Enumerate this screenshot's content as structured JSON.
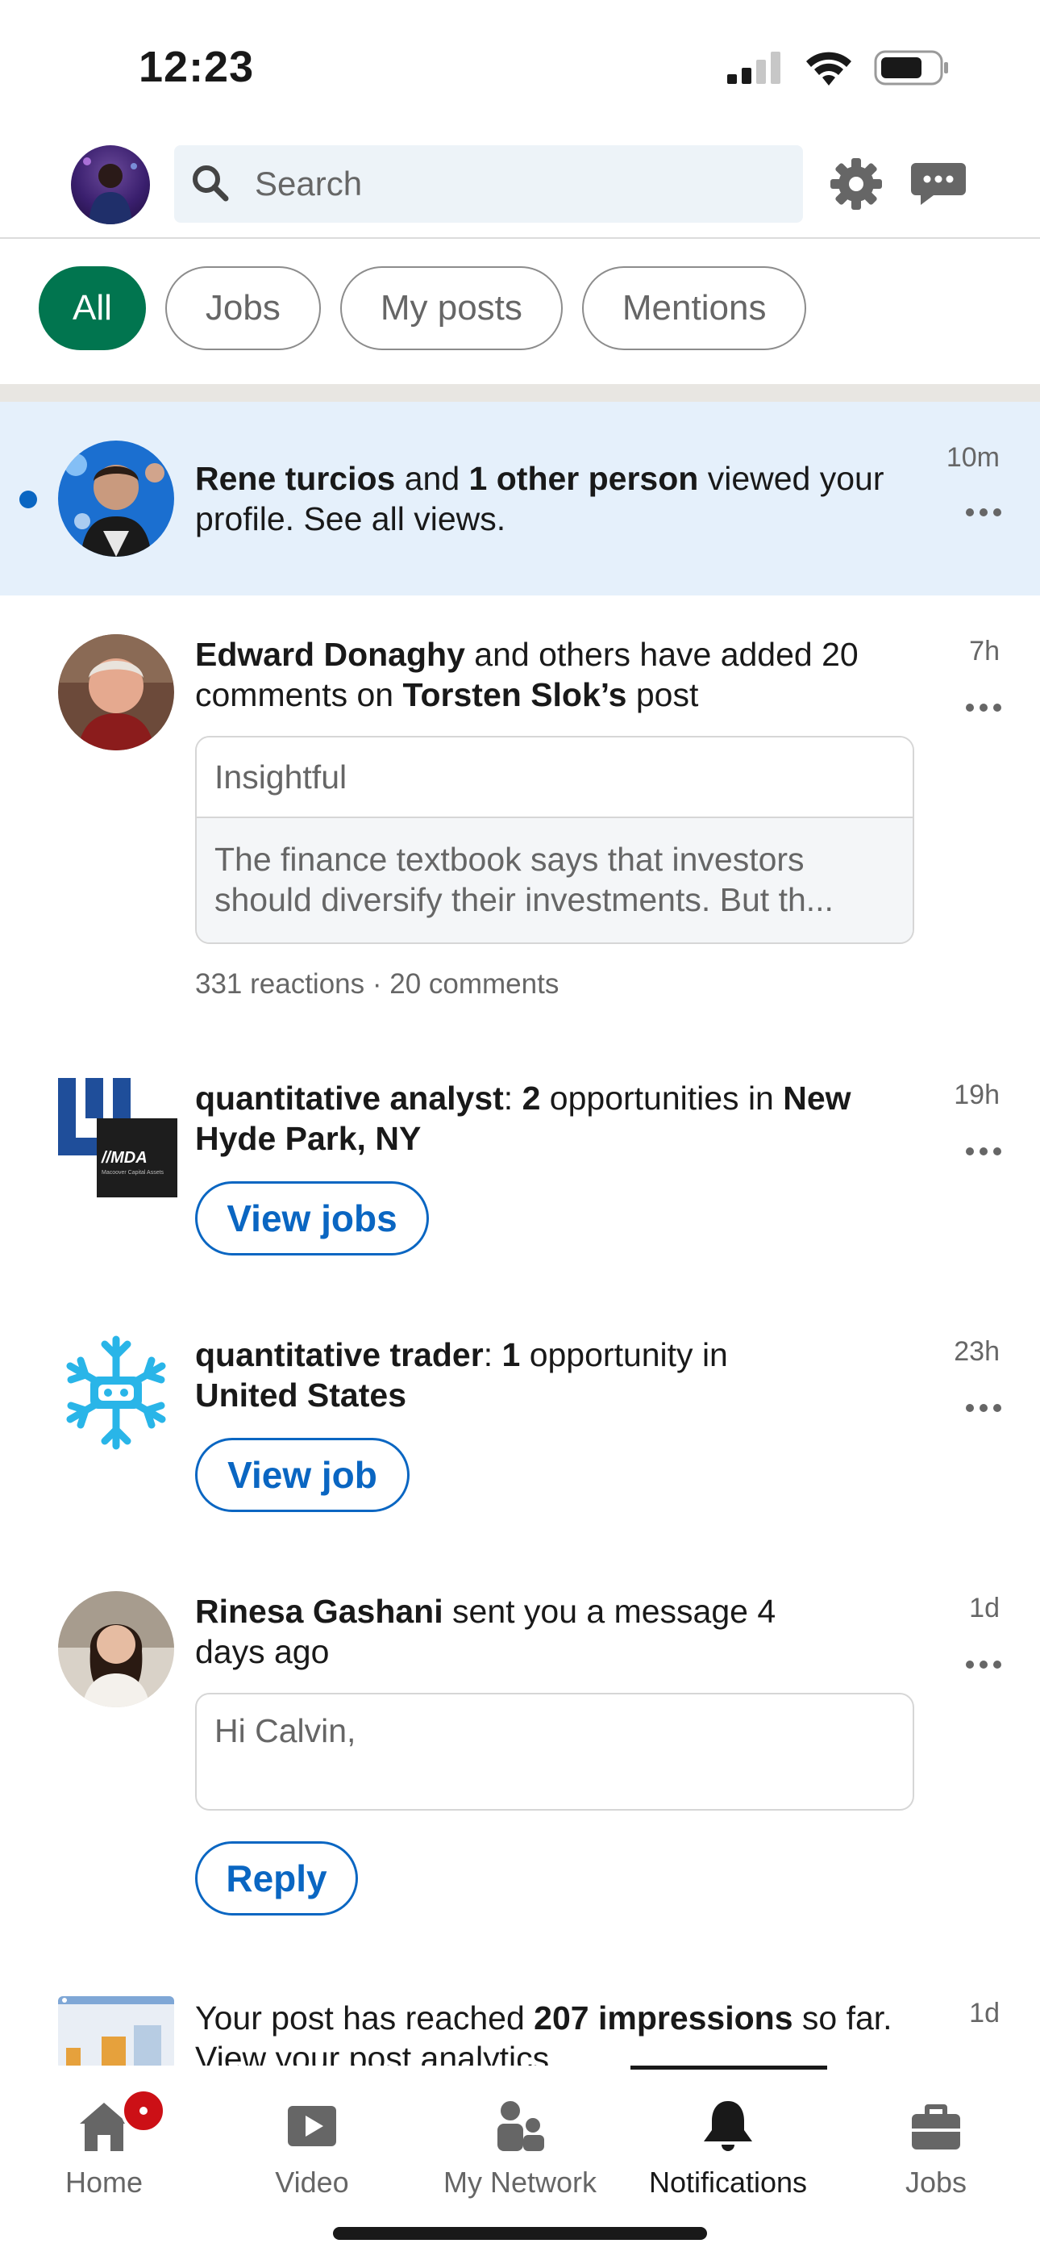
{
  "status_bar": {
    "time": "12:23"
  },
  "header": {
    "search_placeholder": "Search"
  },
  "filters": {
    "all": "All",
    "jobs": "Jobs",
    "my_posts": "My posts",
    "mentions": "Mentions"
  },
  "notifications": [
    {
      "name": "Rene turcios",
      "connector": " and ",
      "highlight": "1 other person",
      "suffix": " viewed your profile. See all views.",
      "time": "10m"
    },
    {
      "name": "Edward Donaghy",
      "middle": " and others have added 20 comments on ",
      "post_author": "Torsten Slok’s",
      "suffix": " post",
      "time": "7h",
      "card_title": "Insightful",
      "card_body": "The finance textbook says that investors should diversify their investments. But th...",
      "meta": "331 reactions · 20 comments"
    },
    {
      "job": "quantitative analyst",
      "colon": ": ",
      "count": "2",
      "middle": " opportunities in ",
      "location": "New Hyde Park, NY",
      "time": "19h",
      "button": "View jobs",
      "logo_text": "//MDA",
      "logo_sub": "Macoover Capital Assets"
    },
    {
      "job": "quantitative trader",
      "colon": ": ",
      "count": "1",
      "middle": " opportunity in ",
      "location": "United States",
      "time": "23h",
      "button": "View job"
    },
    {
      "name": "Rinesa Gashani",
      "suffix": " sent you a message 4 days ago",
      "time": "1d",
      "message": "Hi Calvin,",
      "button": "Reply"
    },
    {
      "prefix": "Your post has reached ",
      "highlight": "207 impressions",
      "suffix": " so far. View your post analytics",
      "time": "1d"
    }
  ],
  "tabs": [
    {
      "label": "Home",
      "icon": "home-icon"
    },
    {
      "label": "Video",
      "icon": "video-icon"
    },
    {
      "label": "My Network",
      "icon": "network-icon"
    },
    {
      "label": "Notifications",
      "icon": "bell-icon",
      "active": true
    },
    {
      "label": "Jobs",
      "icon": "briefcase-icon"
    }
  ],
  "colors": {
    "accent_green": "#01754f",
    "link_blue": "#0a66c2",
    "unread_bg": "#e5f0fb",
    "badge_red": "#cc1016"
  }
}
